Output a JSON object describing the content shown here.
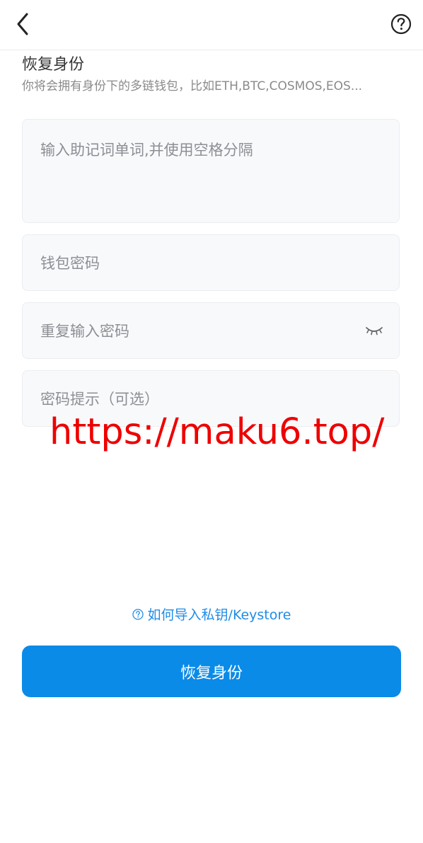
{
  "header": {
    "back_icon": "chevron-left-icon",
    "help_icon": "question-circle-icon"
  },
  "page": {
    "title": "恢复身份",
    "subtitle": "你将会拥有身份下的多链钱包，比如ETH,BTC,COSMOS,EOS..."
  },
  "form": {
    "mnemonic_placeholder": "输入助记词单词,并使用空格分隔",
    "password_placeholder": "钱包密码",
    "repeat_password_placeholder": "重复输入密码",
    "password_hint_placeholder": "密码提示（可选）",
    "eye_icon": "eye-closed-icon"
  },
  "watermark": "https://maku6.top/",
  "help_link": {
    "icon": "question-circle-icon",
    "label": "如何导入私钥/Keystore"
  },
  "submit_button": "恢复身份",
  "colors": {
    "primary": "#0b8be8",
    "link": "#1f8ce6",
    "watermark": "#ee0000",
    "field_bg": "#f8f9fb"
  }
}
